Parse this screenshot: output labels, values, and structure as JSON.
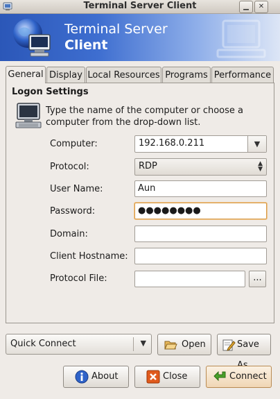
{
  "window": {
    "title": "Terminal Server Client"
  },
  "banner": {
    "line1": "Terminal Server",
    "line2": "Client"
  },
  "tabs": [
    {
      "label": "General",
      "active": true
    },
    {
      "label": "Display"
    },
    {
      "label": "Local Resources"
    },
    {
      "label": "Programs"
    },
    {
      "label": "Performance"
    }
  ],
  "logon": {
    "title": "Logon Settings",
    "description": "Type the name of the computer or choose a computer from the drop-down list.",
    "computer_label": "Computer:",
    "computer_value": "192.168.0.211",
    "protocol_label": "Protocol:",
    "protocol_value": "RDP",
    "username_label": "User Name:",
    "username_value": "Aun",
    "password_label": "Password:",
    "password_value": "●●●●●●●●",
    "domain_label": "Domain:",
    "domain_value": "",
    "hostname_label": "Client Hostname:",
    "hostname_value": "",
    "protocol_file_label": "Protocol File:",
    "protocol_file_value": "",
    "browse_label": "..."
  },
  "quick_connect": {
    "value": "Quick Connect"
  },
  "buttons": {
    "open": "Open",
    "save_as": "Save As",
    "about": "About",
    "close": "Close",
    "connect": "Connect"
  },
  "icons": {
    "window_menu": "terminal-icon",
    "banner": "globe-computer-icon",
    "open": "folder-open-icon",
    "save_as": "save-as-icon",
    "about": "info-icon",
    "close": "close-x-icon",
    "connect": "connect-arrow-icon"
  }
}
